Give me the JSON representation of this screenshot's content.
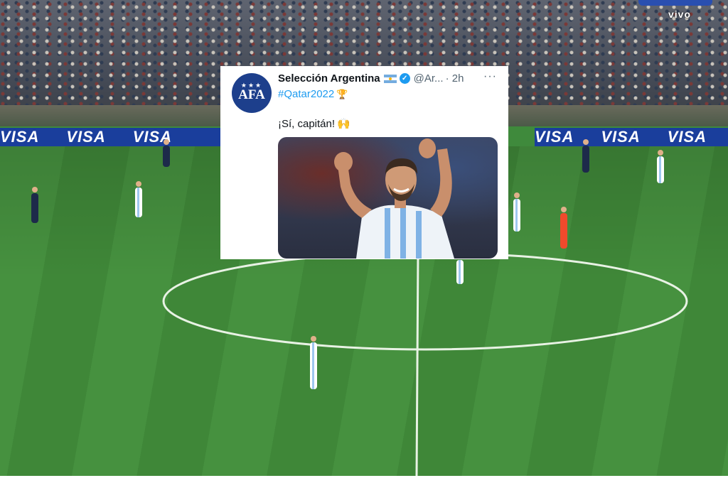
{
  "broadcast": {
    "ad_boards": [
      "VISA",
      "VISA",
      "VISA",
      "VISA"
    ],
    "channel_label": "vivo"
  },
  "tweet": {
    "avatar_text": "AFA",
    "account_name": "Selección Argentina",
    "handle": "@Ar...",
    "time": "· 2h",
    "more_label": "···",
    "hashtag": "#Qatar2022",
    "message": "¡Sí, capitán!",
    "icons": [
      "flag-argentina-icon",
      "verified-badge-icon",
      "trophy-icon",
      "raised-hands-icon"
    ],
    "colors": {
      "link": "#1d9bf0",
      "verified": "#1d9bf0",
      "avatar_bg": "#1d3f8c"
    }
  },
  "colors": {
    "ad_board": "#1a3e9c",
    "pitch": "#46913f"
  }
}
